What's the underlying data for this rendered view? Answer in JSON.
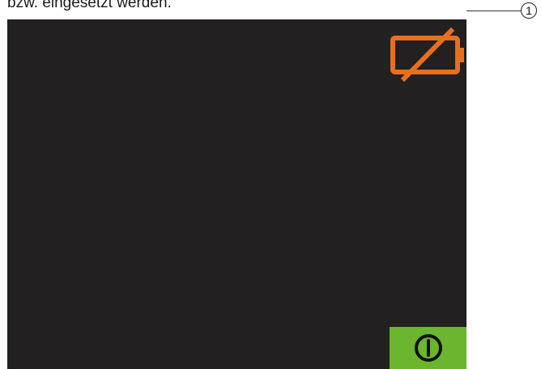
{
  "document": {
    "intro_text": "bzw. eingesetzt werden.",
    "callout_number": "1"
  },
  "display": {
    "status_icon": "battery-empty-icon",
    "button_icon": "power-icon",
    "colors": {
      "screen_background": "#222020",
      "battery_warning": "#e86f1e",
      "power_button": "#6bb52f"
    }
  }
}
